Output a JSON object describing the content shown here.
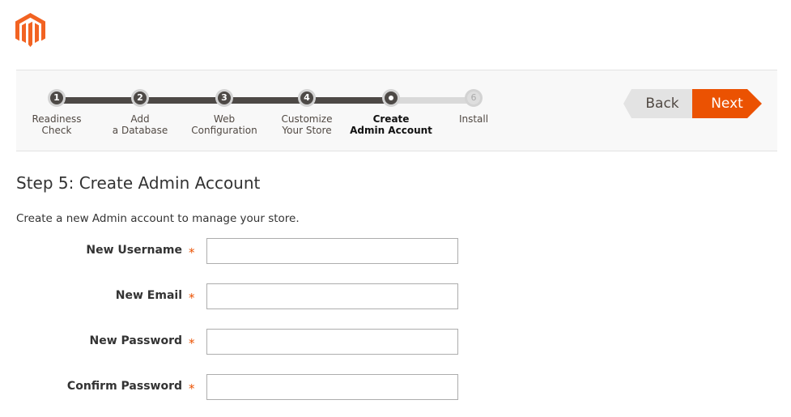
{
  "brand": {
    "logo": "magento-logo-icon",
    "accent": "#eb5202"
  },
  "progress": {
    "current_step": 5,
    "steps": [
      {
        "num": "1",
        "line1": "Readiness",
        "line2": "Check",
        "state": "done"
      },
      {
        "num": "2",
        "line1": "Add",
        "line2": "a Database",
        "state": "done"
      },
      {
        "num": "3",
        "line1": "Web",
        "line2": "Configuration",
        "state": "done"
      },
      {
        "num": "4",
        "line1": "Customize",
        "line2": "Your Store",
        "state": "done"
      },
      {
        "num": "",
        "line1": "Create",
        "line2": "Admin Account",
        "state": "current"
      },
      {
        "num": "6",
        "line1": "Install",
        "line2": "",
        "state": "todo"
      }
    ]
  },
  "buttons": {
    "back": "Back",
    "next": "Next"
  },
  "page": {
    "title": "Step 5: Create Admin Account",
    "intro": "Create a new Admin account to manage your store."
  },
  "form": {
    "required_mark": "*",
    "fields": [
      {
        "label": "New Username",
        "value": ""
      },
      {
        "label": "New Email",
        "value": ""
      },
      {
        "label": "New Password",
        "value": ""
      },
      {
        "label": "Confirm Password",
        "value": ""
      }
    ]
  }
}
